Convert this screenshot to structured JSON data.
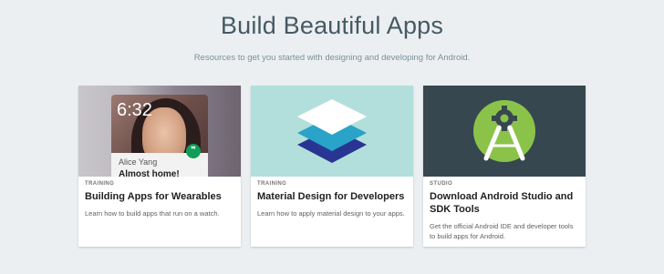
{
  "header": {
    "title": "Build Beautiful Apps",
    "subtitle": "Resources to get you started with designing and developing for Android."
  },
  "cards": [
    {
      "kicker": "TRAINING",
      "title": "Building Apps for Wearables",
      "description": "Learn how to build apps that run on a watch.",
      "media": {
        "time": "6:32",
        "contact_name": "Alice Yang",
        "message": "Almost home!",
        "icon": "hangouts-icon"
      }
    },
    {
      "kicker": "TRAINING",
      "title": "Material Design for Developers",
      "description": "Learn how to apply material design to your apps.",
      "media": {
        "icon": "material-layers-icon"
      }
    },
    {
      "kicker": "STUDIO",
      "title": "Download Android Studio and SDK Tools",
      "description": "Get the official Android IDE and developer tools to build apps for Android.",
      "media": {
        "icon": "android-studio-icon"
      }
    }
  ],
  "colors": {
    "background": "#eceff1",
    "material_bg": "#b2dfdb",
    "studio_bg": "#37474f",
    "studio_green": "#8bc34a"
  }
}
